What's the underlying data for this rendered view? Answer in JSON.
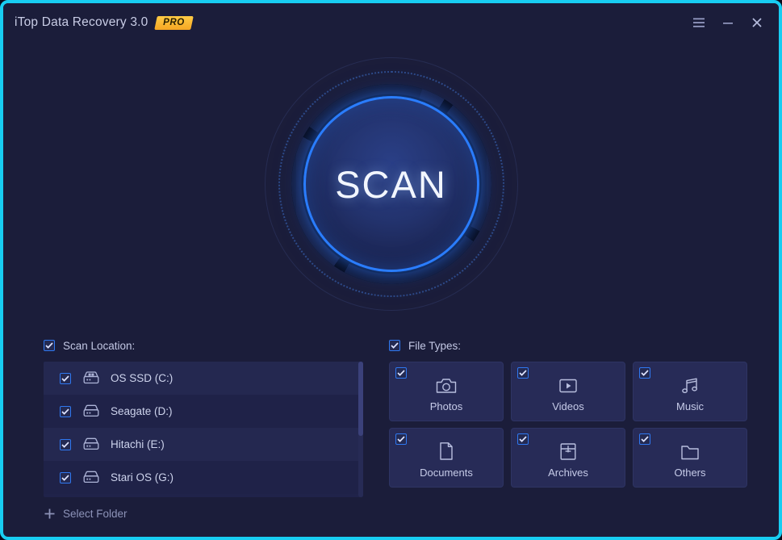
{
  "titlebar": {
    "app_title": "iTop Data Recovery 3.0",
    "pro_badge": "PRO",
    "menu_icon": "hamburger-menu-icon",
    "minimize_icon": "minimize-icon",
    "close_icon": "close-icon"
  },
  "scan": {
    "button_label": "SCAN"
  },
  "scan_location": {
    "header_label": "Scan Location:",
    "header_checked": true,
    "drives": [
      {
        "label": "OS SSD (C:)",
        "icon": "ssd-drive-icon",
        "checked": true
      },
      {
        "label": "Seagate (D:)",
        "icon": "hdd-drive-icon",
        "checked": true
      },
      {
        "label": "Hitachi (E:)",
        "icon": "hdd-drive-icon",
        "checked": true
      },
      {
        "label": "Stari OS (G:)",
        "icon": "hdd-drive-icon",
        "checked": true
      }
    ],
    "select_folder_label": "Select Folder",
    "select_folder_icon": "plus-icon"
  },
  "file_types": {
    "header_label": "File Types:",
    "header_checked": true,
    "items": [
      {
        "label": "Photos",
        "icon": "camera-icon",
        "checked": true
      },
      {
        "label": "Videos",
        "icon": "video-play-icon",
        "checked": true
      },
      {
        "label": "Music",
        "icon": "music-note-icon",
        "checked": true
      },
      {
        "label": "Documents",
        "icon": "document-page-icon",
        "checked": true
      },
      {
        "label": "Archives",
        "icon": "archive-box-icon",
        "checked": true
      },
      {
        "label": "Others",
        "icon": "folder-icon",
        "checked": true
      }
    ]
  },
  "colors": {
    "window_border": "#18cdf2",
    "background": "#1b1d3a",
    "accent_blue": "#2a7dff",
    "checkbox_border": "#2f78f0",
    "pro_gold": "#f5a623",
    "panel_card": "#272b57",
    "text_primary": "#cdd3ec",
    "text_muted": "#8d93b8"
  }
}
